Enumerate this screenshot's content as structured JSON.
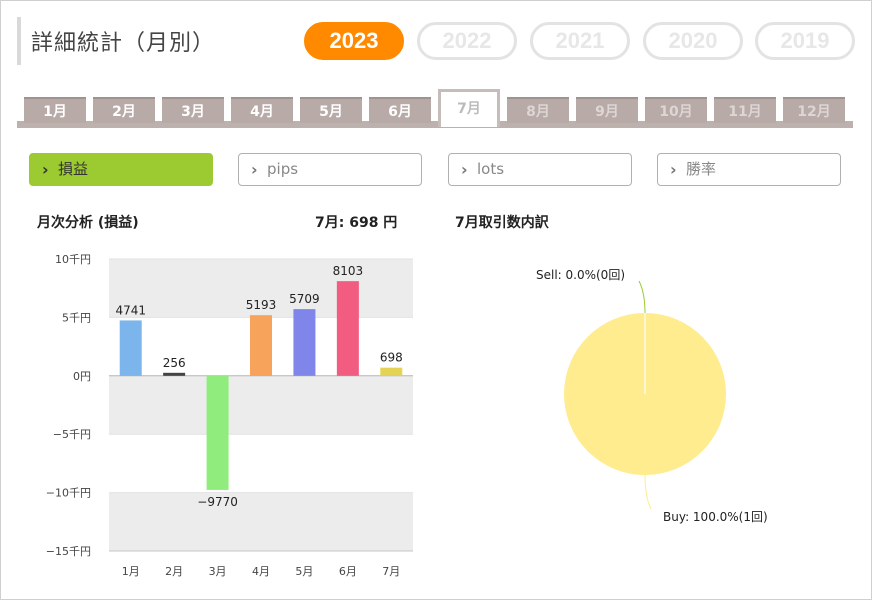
{
  "header": {
    "title": "詳細統計（月別）",
    "years": [
      {
        "label": "2023",
        "active": true
      },
      {
        "label": "2022",
        "active": false
      },
      {
        "label": "2021",
        "active": false
      },
      {
        "label": "2020",
        "active": false
      },
      {
        "label": "2019",
        "active": false
      }
    ]
  },
  "months": [
    {
      "label": "1月",
      "state": "normal"
    },
    {
      "label": "2月",
      "state": "normal"
    },
    {
      "label": "3月",
      "state": "normal"
    },
    {
      "label": "4月",
      "state": "normal"
    },
    {
      "label": "5月",
      "state": "normal"
    },
    {
      "label": "6月",
      "state": "normal"
    },
    {
      "label": "7月",
      "state": "active"
    },
    {
      "label": "8月",
      "state": "dim"
    },
    {
      "label": "9月",
      "state": "dim"
    },
    {
      "label": "10月",
      "state": "dim"
    },
    {
      "label": "11月",
      "state": "dim"
    },
    {
      "label": "12月",
      "state": "dim"
    }
  ],
  "metrics": [
    {
      "label": "損益",
      "active": true,
      "icon": "chevron-right-icon"
    },
    {
      "label": "pips",
      "active": false,
      "icon": "chevron-right-icon"
    },
    {
      "label": "lots",
      "active": false,
      "icon": "chevron-right-icon"
    },
    {
      "label": "勝率",
      "active": false,
      "icon": "chevron-right-icon"
    }
  ],
  "monthly": {
    "title": "月次分析 (損益)",
    "summary": "7月:  698 円"
  },
  "pie_section": {
    "title": "7月取引数内訳"
  },
  "chart_data": [
    {
      "type": "bar",
      "categories": [
        "1月",
        "2月",
        "3月",
        "4月",
        "5月",
        "6月",
        "7月"
      ],
      "values": [
        4741,
        256,
        -9770,
        5193,
        5709,
        8103,
        698
      ],
      "colors": [
        "#7cb5ec",
        "#434348",
        "#90ed7d",
        "#f7a35c",
        "#8085e9",
        "#f15c80",
        "#e4d354"
      ],
      "y_ticks": [
        {
          "value": 10000,
          "label": "10千円"
        },
        {
          "value": 5000,
          "label": "5千円"
        },
        {
          "value": 0,
          "label": "0円"
        },
        {
          "value": -5000,
          "label": "−5千円"
        },
        {
          "value": -10000,
          "label": "−10千円"
        },
        {
          "value": -15000,
          "label": "−15千円"
        }
      ],
      "ylim": [
        -15000,
        10000
      ],
      "grid": "alternating bands"
    },
    {
      "type": "pie",
      "slices": [
        {
          "name": "Sell",
          "value": 0.0,
          "label": "Sell: 0.0%(0回)",
          "color": "#9ccb31"
        },
        {
          "name": "Buy",
          "value": 100.0,
          "label": "Buy: 100.0%(1回)",
          "color": "#ffec8f"
        }
      ]
    }
  ]
}
